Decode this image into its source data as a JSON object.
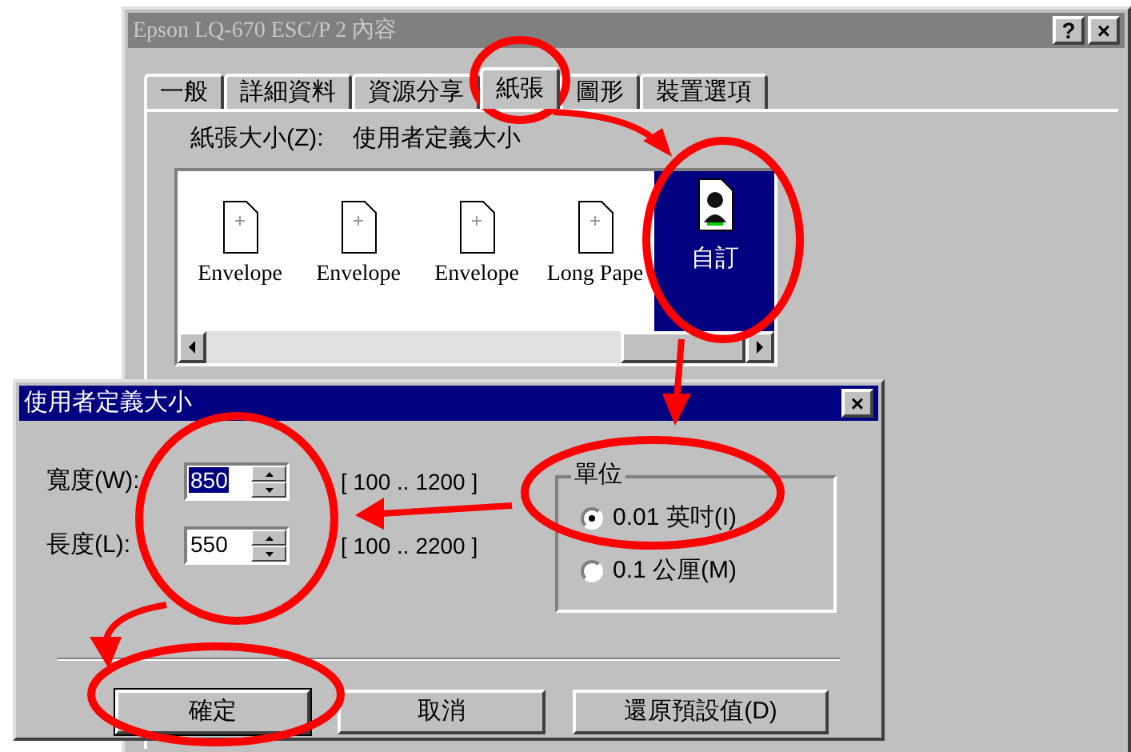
{
  "properties_window": {
    "title": "Epson LQ-670 ESC/P 2 內容",
    "title_buttons": [
      "?",
      "×"
    ],
    "tabs": [
      {
        "label": "一般",
        "selected": false
      },
      {
        "label": "詳細資料",
        "selected": false
      },
      {
        "label": "資源分享",
        "selected": false
      },
      {
        "label": "紙張",
        "selected": true
      },
      {
        "label": "圖形",
        "selected": false
      },
      {
        "label": "裝置選項",
        "selected": false
      }
    ],
    "paper_size_label": "紙張大小(Z):",
    "paper_size_value": "使用者定義大小",
    "papers": [
      {
        "label": "Envelope",
        "kind": "blank",
        "selected": false
      },
      {
        "label": "Envelope",
        "kind": "blank",
        "selected": false
      },
      {
        "label": "Envelope",
        "kind": "blank",
        "selected": false
      },
      {
        "label": "Long Pape",
        "kind": "blank",
        "selected": false
      },
      {
        "label": "自訂",
        "kind": "custom",
        "selected": true
      }
    ]
  },
  "custom_size_dialog": {
    "title": "使用者定義大小",
    "close": "×",
    "fields": [
      {
        "label": "寬度(W):",
        "value": "850",
        "selected": true,
        "range": "[ 100 .. 1200 ]"
      },
      {
        "label": "長度(L):",
        "value": "550",
        "selected": false,
        "range": "[ 100 .. 2200 ]"
      }
    ],
    "unit_group": {
      "title": "單位",
      "options": [
        {
          "label": "0.01 英吋(I)",
          "selected": true
        },
        {
          "label": "0.1 公厘(M)",
          "selected": false
        }
      ]
    },
    "buttons": [
      {
        "label": "確定",
        "default": true
      },
      {
        "label": "取消",
        "default": false
      },
      {
        "label": "還原預設值(D)",
        "default": false
      }
    ]
  }
}
